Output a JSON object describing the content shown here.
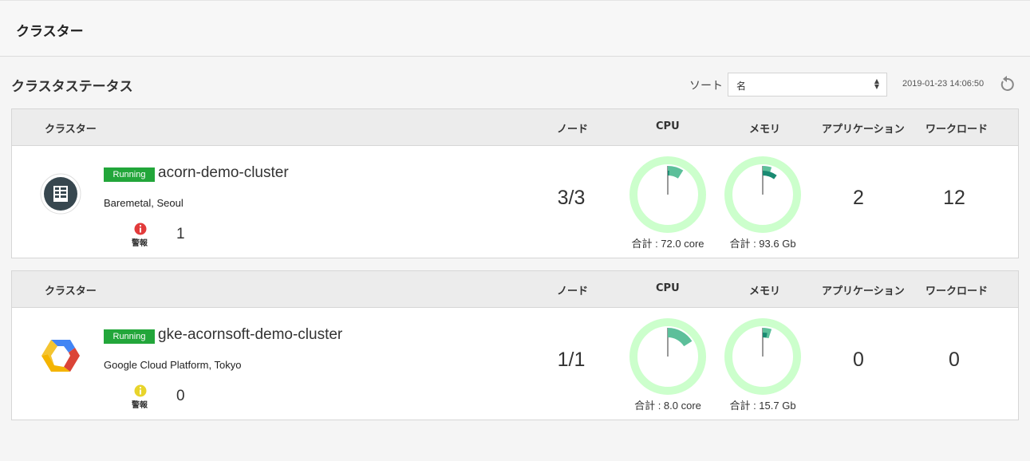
{
  "page": {
    "title": "クラスター"
  },
  "status": {
    "title": "クラスタステータス",
    "sort_label": "ソート",
    "sort_value": "名",
    "timestamp": "2019-01-23 14:06:50"
  },
  "columns": {
    "cluster": "クラスター",
    "node": "ノード",
    "cpu": "CPU",
    "memory": "メモリ",
    "application": "アプリケーション",
    "workload": "ワークロード"
  },
  "clusters": [
    {
      "status": "Running",
      "name": "acorn-demo-cluster",
      "location": "Baremetal, Seoul",
      "logo": "baremetal-server-icon",
      "alert_label": "警報",
      "alert_color": "#e23b3b",
      "alert_count": "1",
      "nodes": "3/3",
      "cpu_caption": "合計 : 72.0 core",
      "cpu_usage_a": 0.09,
      "cpu_usage_b": 0.01,
      "memory_caption": "合計 : 93.6 Gb",
      "memory_usage_a": 0.05,
      "memory_usage_b": 0.1,
      "applications": "2",
      "workloads": "12"
    },
    {
      "status": "Running",
      "name": "gke-acornsoft-demo-cluster",
      "location": "Google Cloud Platform, Tokyo",
      "logo": "google-cloud-platform-icon",
      "alert_label": "警報",
      "alert_color": "#e8d42b",
      "alert_count": "0",
      "nodes": "1/1",
      "cpu_caption": "合計 : 8.0 core",
      "cpu_usage_a": 0.16,
      "cpu_usage_b": 0.0,
      "memory_caption": "合計 : 15.7 Gb",
      "memory_usage_a": 0.05,
      "memory_usage_b": 0.03,
      "applications": "0",
      "workloads": "0"
    }
  ],
  "colors": {
    "running": "#22a63a",
    "gauge_track": "#ccffcc",
    "gauge_primary": "#5cbf9a",
    "gauge_secondary": "#1a8a72"
  }
}
